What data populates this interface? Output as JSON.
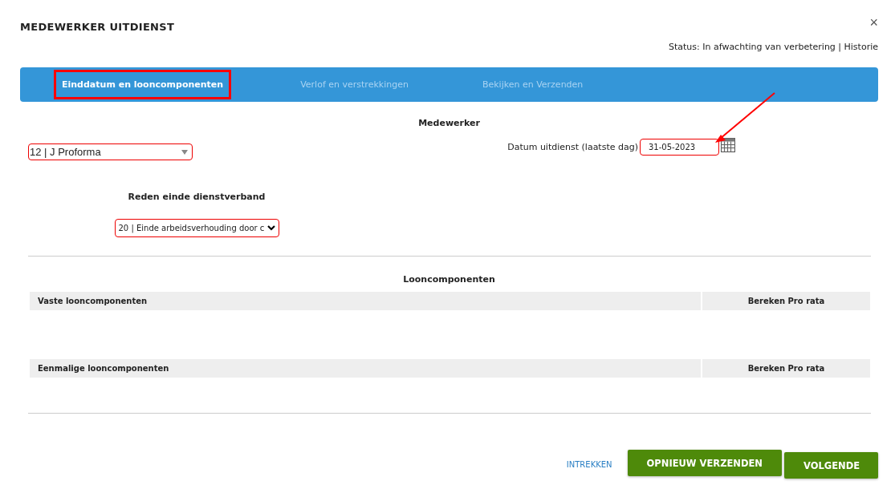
{
  "dialog": {
    "title": "MEDEWERKER UITDIENST",
    "close": "×",
    "status": "Status: In afwachting van verbetering | Historie"
  },
  "tabs": [
    {
      "label": "Einddatum en looncomponenten",
      "selected": true
    },
    {
      "label": "Verlof en verstrekkingen",
      "selected": false
    },
    {
      "label": "Bekijken en Verzenden",
      "selected": false
    }
  ],
  "employee": {
    "heading": "Medewerker",
    "value": "12 | J Proforma",
    "date_label": "Datum uitdienst (laatste dag)",
    "date_value": "31-05-2023"
  },
  "reason": {
    "heading": "Reden einde dienstverband",
    "value": "20 | Einde arbeidsverhouding door c"
  },
  "components": {
    "heading": "Looncomponenten",
    "tables": [
      {
        "column_1": "Vaste looncomponenten",
        "column_2": "Bereken Pro rata"
      },
      {
        "column_1": "Eenmalige looncomponenten",
        "column_2": "Bereken Pro rata"
      }
    ]
  },
  "actions": {
    "link": "INTREKKEN",
    "buttons": [
      "OPNIEUW VERZENDEN",
      "VOLGENDE"
    ]
  }
}
